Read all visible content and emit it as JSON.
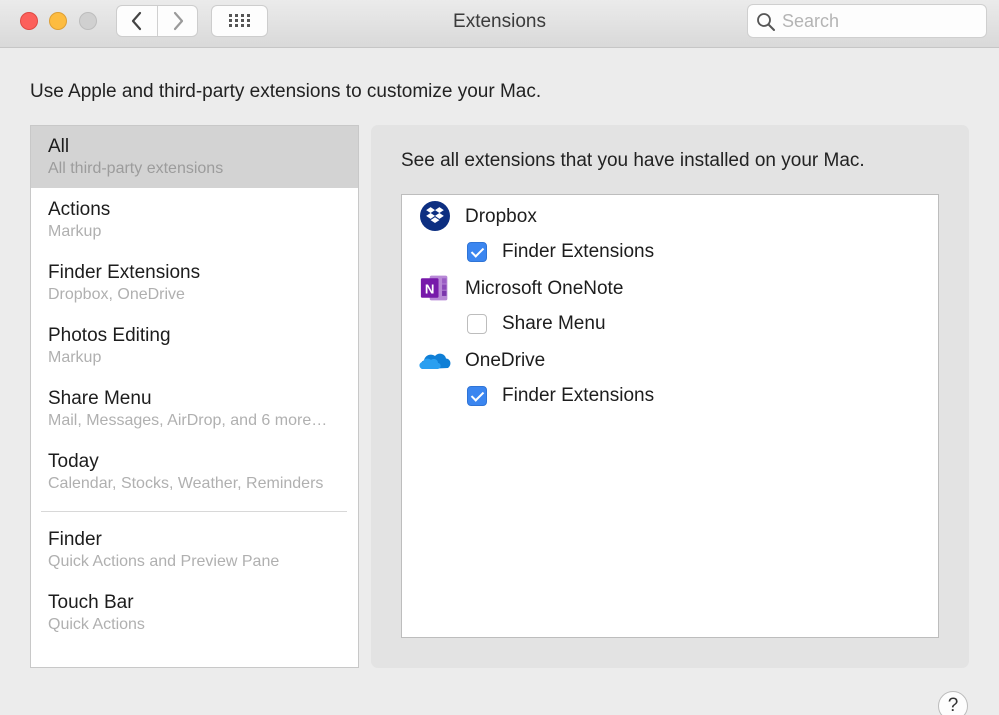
{
  "window": {
    "title": "Extensions"
  },
  "toolbar": {
    "search_placeholder": "Search"
  },
  "intro": "Use Apple and third-party extensions to customize your Mac.",
  "categories": [
    {
      "title": "All",
      "subtitle": "All third-party extensions",
      "selected": true
    },
    {
      "title": "Actions",
      "subtitle": "Markup"
    },
    {
      "title": "Finder Extensions",
      "subtitle": "Dropbox, OneDrive"
    },
    {
      "title": "Photos Editing",
      "subtitle": "Markup"
    },
    {
      "title": "Share Menu",
      "subtitle": "Mail, Messages, AirDrop, and 6 more…"
    },
    {
      "title": "Today",
      "subtitle": "Calendar, Stocks, Weather, Reminders"
    },
    {
      "title": "Finder",
      "subtitle": "Quick Actions and Preview Pane"
    },
    {
      "title": "Touch Bar",
      "subtitle": "Quick Actions"
    }
  ],
  "panel": {
    "description": "See all extensions that you have installed on your Mac.",
    "apps": [
      {
        "name": "Dropbox",
        "icon": "dropbox-icon",
        "extensions": [
          {
            "label": "Finder Extensions",
            "checked": true
          }
        ]
      },
      {
        "name": "Microsoft OneNote",
        "icon": "onenote-icon",
        "extensions": [
          {
            "label": "Share Menu",
            "checked": false
          }
        ]
      },
      {
        "name": "OneDrive",
        "icon": "onedrive-icon",
        "extensions": [
          {
            "label": "Finder Extensions",
            "checked": true
          }
        ]
      }
    ]
  },
  "help": {
    "label": "?"
  },
  "colors": {
    "accent": "#3b86f0",
    "selection": "#d3d3d3",
    "dropbox": "#0d2f81",
    "onenote": "#7719aa",
    "onedrive": "#0f7fd6"
  }
}
